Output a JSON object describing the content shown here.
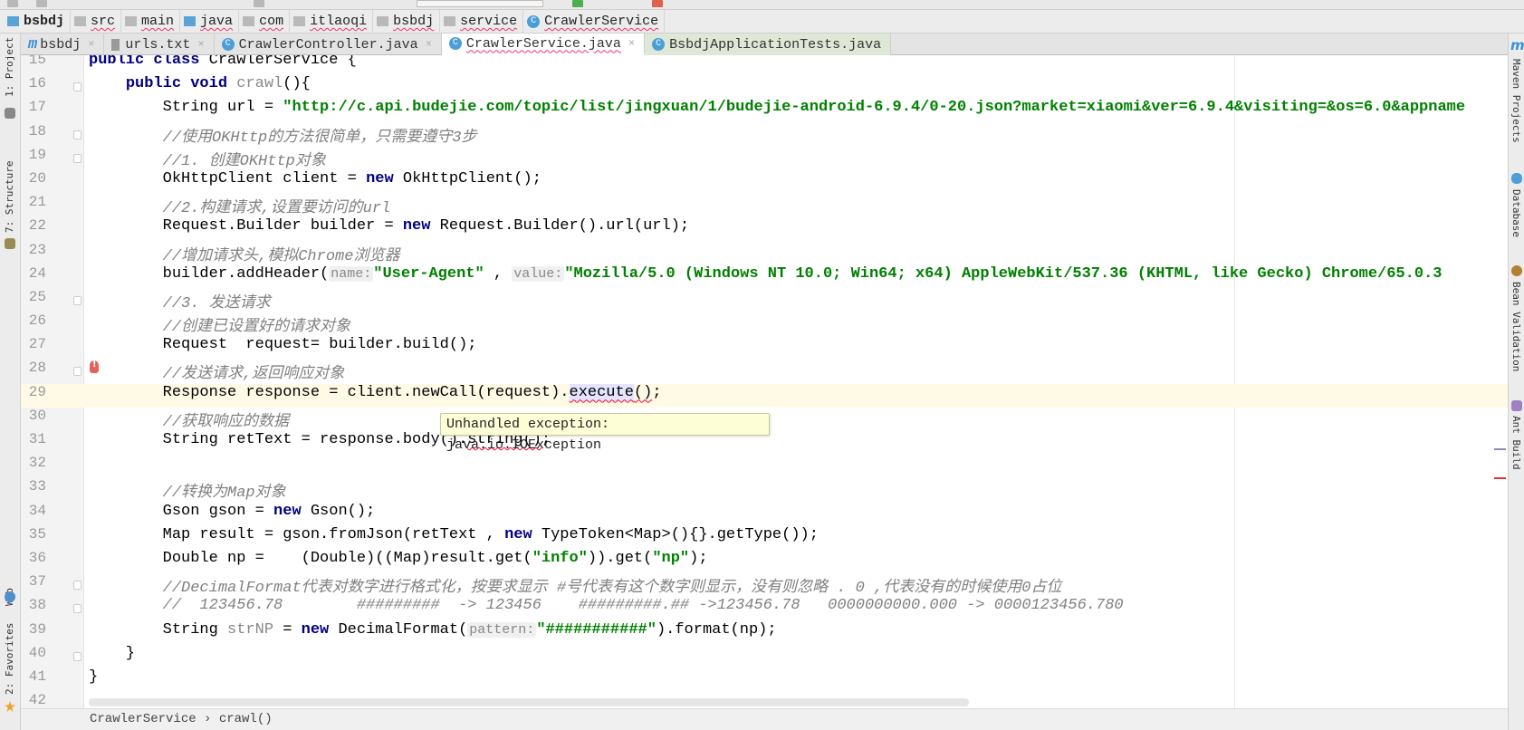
{
  "breadcrumb": [
    "bsbdj",
    "src",
    "main",
    "java",
    "com",
    "itlaoqi",
    "bsbdj",
    "service",
    "CrawlerService"
  ],
  "tabs": [
    {
      "label": "bsbdj",
      "icon": "maven-module-icon"
    },
    {
      "label": "urls.txt",
      "icon": "text-file-icon"
    },
    {
      "label": "CrawlerController.java",
      "icon": "java-class-icon"
    },
    {
      "label": "CrawlerService.java",
      "icon": "java-class-icon",
      "active": true
    },
    {
      "label": "BsbdjApplicationTests.java",
      "icon": "java-test-class-icon"
    }
  ],
  "left_tools": [
    "1: Project",
    "7: Structure",
    "Web",
    "2: Favorites"
  ],
  "right_tools": [
    "Maven Projects",
    "Database",
    "Bean Validation",
    "Ant Build"
  ],
  "tooltip": "Unhandled exception: java.io.IOException",
  "status_breadcrumb": "CrawlerService › crawl()",
  "current_line": 29,
  "colors": {
    "keyword": "#000080",
    "string": "#008000",
    "comment": "#808080",
    "current_line": "#fffae6",
    "tooltip": "#fdfdd6"
  },
  "code": [
    {
      "n": 15,
      "t": [
        [
          "kw",
          "public class "
        ],
        [
          "p",
          "CrawlerService {"
        ]
      ]
    },
    {
      "n": 16,
      "t": [
        [
          "p",
          "    "
        ],
        [
          "kw",
          "public void "
        ],
        [
          "un",
          "crawl"
        ],
        [
          "p",
          "(){"
        ]
      ]
    },
    {
      "n": 17,
      "t": [
        [
          "p",
          "        String url = "
        ],
        [
          "str",
          "\"http://c.api.budejie.com/topic/list/jingxuan/1/budejie-android-6.9.4/0-20.json?market=xiaomi&ver=6.9.4&visiting=&os=6.0&appname"
        ]
      ]
    },
    {
      "n": 18,
      "t": [
        [
          "p",
          "        "
        ],
        [
          "cm",
          "//使用OKHttp的方法很简单，只需要遵守3步"
        ]
      ]
    },
    {
      "n": 19,
      "t": [
        [
          "p",
          "        "
        ],
        [
          "cm",
          "//1. 创建OKHttp对象"
        ]
      ]
    },
    {
      "n": 20,
      "t": [
        [
          "p",
          "        OkHttpClient client = "
        ],
        [
          "kw",
          "new "
        ],
        [
          "p",
          "OkHttpClient();"
        ]
      ]
    },
    {
      "n": 21,
      "t": [
        [
          "p",
          "        "
        ],
        [
          "cm",
          "//2.构建请求,设置要访问的url"
        ]
      ]
    },
    {
      "n": 22,
      "t": [
        [
          "p",
          "        Request.Builder builder = "
        ],
        [
          "kw",
          "new "
        ],
        [
          "p",
          "Request.Builder().url(url);"
        ]
      ]
    },
    {
      "n": 23,
      "t": [
        [
          "p",
          "        "
        ],
        [
          "cm",
          "//增加请求头,模拟Chrome浏览器"
        ]
      ]
    },
    {
      "n": 24,
      "t": [
        [
          "p",
          "        builder.addHeader("
        ],
        [
          "hint",
          "name:"
        ],
        [
          "str",
          "\"User-Agent\""
        ],
        [
          "p",
          " , "
        ],
        [
          "hint",
          "value:"
        ],
        [
          "str",
          "\"Mozilla/5.0 (Windows NT 10.0; Win64; x64) AppleWebKit/537.36 (KHTML, like Gecko) Chrome/65.0.3"
        ]
      ]
    },
    {
      "n": 25,
      "t": [
        [
          "p",
          "        "
        ],
        [
          "cm",
          "//3. 发送请求"
        ]
      ]
    },
    {
      "n": 26,
      "t": [
        [
          "p",
          "        "
        ],
        [
          "cm",
          "//创建已设置好的请求对象"
        ]
      ]
    },
    {
      "n": 27,
      "t": [
        [
          "p",
          "        Request  request= builder.build();"
        ]
      ]
    },
    {
      "n": 28,
      "t": [
        [
          "p",
          "        "
        ],
        [
          "cm",
          "//发送请求,返回响应对象"
        ]
      ]
    },
    {
      "n": 29,
      "t": [
        [
          "p",
          "        Response response = client.newCall(request)."
        ],
        [
          "hl err",
          "execute"
        ],
        [
          "err",
          "()"
        ],
        [
          "p",
          ";"
        ]
      ]
    },
    {
      "n": 30,
      "t": [
        [
          "p",
          "        "
        ],
        [
          "cm",
          "//获取响应的数据"
        ]
      ]
    },
    {
      "n": 31,
      "t": [
        [
          "p",
          "        String retText = response.body()."
        ],
        [
          "err",
          "string()"
        ],
        [
          "p",
          ";"
        ]
      ]
    },
    {
      "n": 32,
      "t": []
    },
    {
      "n": 33,
      "t": [
        [
          "p",
          "        "
        ],
        [
          "cm",
          "//转换为Map对象"
        ]
      ]
    },
    {
      "n": 34,
      "t": [
        [
          "p",
          "        Gson gson = "
        ],
        [
          "kw",
          "new "
        ],
        [
          "p",
          "Gson();"
        ]
      ]
    },
    {
      "n": 35,
      "t": [
        [
          "p",
          "        Map result = gson.fromJson(retText , "
        ],
        [
          "kw",
          "new "
        ],
        [
          "p",
          "TypeToken<Map>(){}.getType());"
        ]
      ]
    },
    {
      "n": 36,
      "t": [
        [
          "p",
          "        Double np =    (Double)((Map)result.get("
        ],
        [
          "str",
          "\"info\""
        ],
        [
          "p",
          ")).get("
        ],
        [
          "str",
          "\"np\""
        ],
        [
          "p",
          ");"
        ]
      ]
    },
    {
      "n": 37,
      "t": [
        [
          "p",
          "        "
        ],
        [
          "cm",
          "//DecimalFormat代表对数字进行格式化，按要求显示 #号代表有这个数字则显示，没有则忽略 . 0 ,代表没有的时候使用0占位"
        ]
      ]
    },
    {
      "n": 38,
      "t": [
        [
          "p",
          "        "
        ],
        [
          "cm",
          "//  123456.78        #########  -> 123456    #########.## ->123456.78   0000000000.000 -> 0000123456.780"
        ]
      ]
    },
    {
      "n": 39,
      "t": [
        [
          "p",
          "        String "
        ],
        [
          "un",
          "strNP"
        ],
        [
          "p",
          " = "
        ],
        [
          "kw",
          "new "
        ],
        [
          "p",
          "DecimalFormat("
        ],
        [
          "hint",
          "pattern:"
        ],
        [
          "str",
          "\"###########\""
        ],
        [
          "p",
          ").format(np);"
        ]
      ]
    },
    {
      "n": 40,
      "t": [
        [
          "p",
          "    }"
        ]
      ]
    },
    {
      "n": 41,
      "t": [
        [
          "p",
          "}"
        ]
      ]
    },
    {
      "n": 42,
      "t": []
    }
  ]
}
